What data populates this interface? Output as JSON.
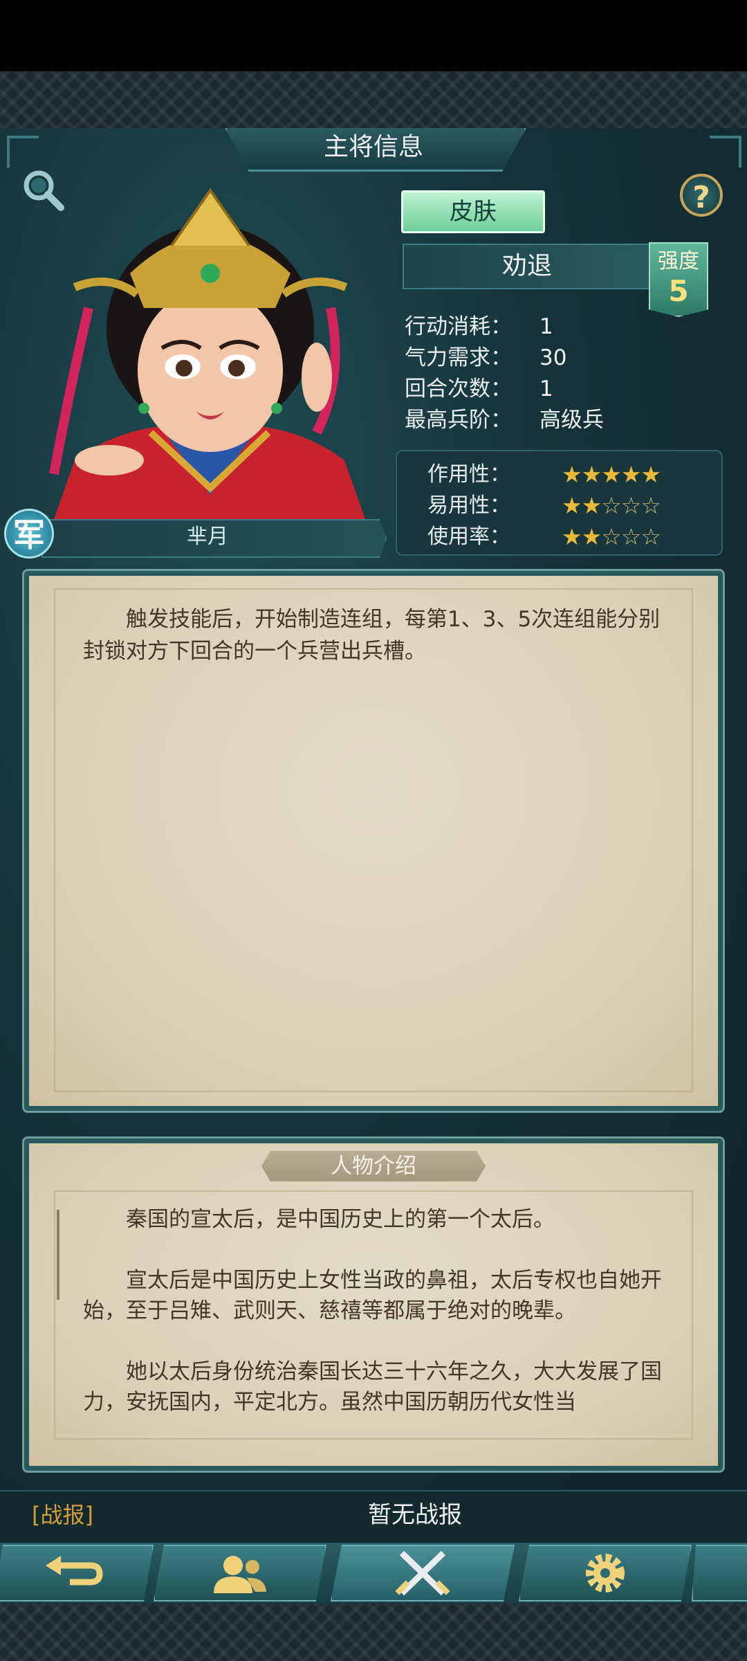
{
  "header": {
    "title": "主将信息"
  },
  "hero": {
    "name": "芈月",
    "faction_badge": "军"
  },
  "skin_button": "皮肤",
  "skill": {
    "name": "劝退",
    "strength_label": "强度",
    "strength_value": "5",
    "description": "　　触发技能后，开始制造连组，每第1、3、5次连组能分别封锁对方下回合的一个兵营出兵槽。"
  },
  "stats": [
    {
      "label": "行动消耗：",
      "value": "1"
    },
    {
      "label": "气力需求：",
      "value": "30"
    },
    {
      "label": "回合次数：",
      "value": "1"
    },
    {
      "label": "最高兵阶：",
      "value": "高级兵"
    }
  ],
  "ratings": [
    {
      "label": "作用性：",
      "stars": 5,
      "max": 5
    },
    {
      "label": "易用性：",
      "stars": 2,
      "max": 5
    },
    {
      "label": "使用率：",
      "stars": 2,
      "max": 5
    }
  ],
  "bio": {
    "heading": "人物介绍",
    "text": "　　秦国的宣太后，是中国历史上的第一个太后。\n\n　　宣太后是中国历史上女性当政的鼻祖，太后专权也自她开始，至于吕雉、武则天、慈禧等都属于绝对的晚辈。\n\n　　她以太后身份统治秦国长达三十六年之久，大大发展了国力，安抚国内，平定北方。虽然中国历朝历代女性当"
  },
  "battle_report": {
    "tab": "[战报]",
    "status": "暂无战报"
  },
  "nav": {
    "items": [
      "back-icon",
      "people-icon",
      "crossed-swords-icon",
      "gear-icon"
    ],
    "active": 2
  },
  "colors": {
    "star_on": "#e9b938",
    "star_off": "#c9b57a",
    "report_tab": "#d69c3d",
    "skin_button": "#8fe0b3"
  }
}
